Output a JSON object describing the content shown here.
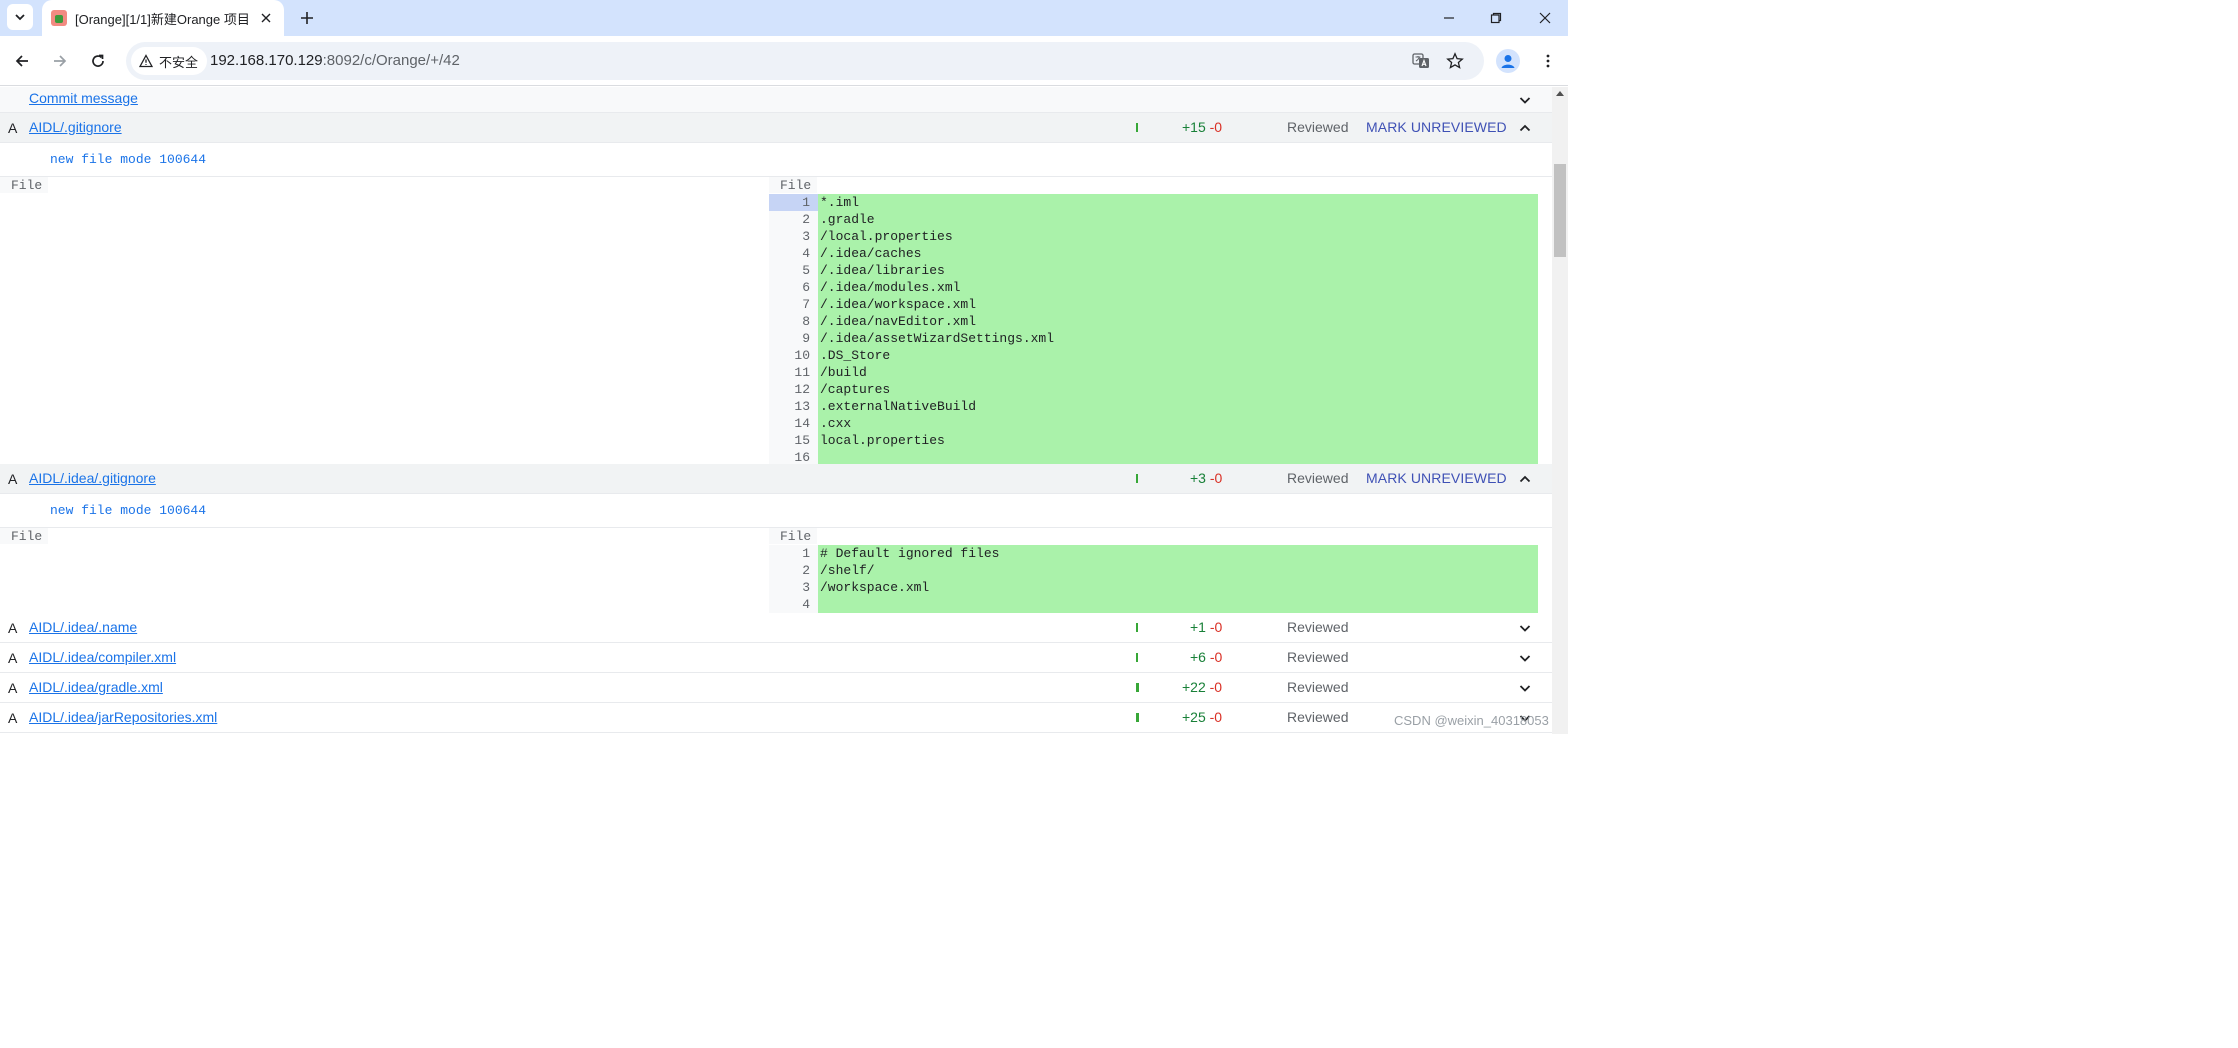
{
  "browser": {
    "tab_title": "[Orange][1/1]新建Orange 项目",
    "security_label": "不安全",
    "url_host": "192.168.170.129",
    "url_rest": ":8092/c/Orange/+/42"
  },
  "page": {
    "commit_message_label": "Commit message",
    "files": [
      {
        "status": "A",
        "path": "AIDL/.gitignore",
        "added": "+15",
        "removed": "-0",
        "reviewed_label": "Reviewed",
        "mark_label": "MARK UNREVIEWED",
        "expanded": true,
        "file_mode": "new file mode 100644",
        "left_header": "File",
        "right_header": "File",
        "lines": [
          {
            "n": "1",
            "text": "*.iml"
          },
          {
            "n": "2",
            "text": ".gradle"
          },
          {
            "n": "3",
            "text": "/local.properties"
          },
          {
            "n": "4",
            "text": "/.idea/caches"
          },
          {
            "n": "5",
            "text": "/.idea/libraries"
          },
          {
            "n": "6",
            "text": "/.idea/modules.xml"
          },
          {
            "n": "7",
            "text": "/.idea/workspace.xml"
          },
          {
            "n": "8",
            "text": "/.idea/navEditor.xml"
          },
          {
            "n": "9",
            "text": "/.idea/assetWizardSettings.xml"
          },
          {
            "n": "10",
            "text": ".DS_Store"
          },
          {
            "n": "11",
            "text": "/build"
          },
          {
            "n": "12",
            "text": "/captures"
          },
          {
            "n": "13",
            "text": ".externalNativeBuild"
          },
          {
            "n": "14",
            "text": ".cxx"
          },
          {
            "n": "15",
            "text": "local.properties"
          },
          {
            "n": "16",
            "text": ""
          }
        ]
      },
      {
        "status": "A",
        "path": "AIDL/.idea/.gitignore",
        "added": "+3",
        "removed": "-0",
        "reviewed_label": "Reviewed",
        "mark_label": "MARK UNREVIEWED",
        "expanded": true,
        "file_mode": "new file mode 100644",
        "left_header": "File",
        "right_header": "File",
        "lines": [
          {
            "n": "1",
            "text": "# Default ignored files"
          },
          {
            "n": "2",
            "text": "/shelf/"
          },
          {
            "n": "3",
            "text": "/workspace.xml"
          },
          {
            "n": "4",
            "text": ""
          }
        ]
      },
      {
        "status": "A",
        "path": "AIDL/.idea/.name",
        "added": "+1",
        "removed": "-0",
        "reviewed_label": "Reviewed"
      },
      {
        "status": "A",
        "path": "AIDL/.idea/compiler.xml",
        "added": "+6",
        "removed": "-0",
        "reviewed_label": "Reviewed"
      },
      {
        "status": "A",
        "path": "AIDL/.idea/gradle.xml",
        "added": "+22",
        "removed": "-0",
        "reviewed_label": "Reviewed"
      },
      {
        "status": "A",
        "path": "AIDL/.idea/jarRepositories.xml",
        "added": "+25",
        "removed": "-0",
        "reviewed_label": "Reviewed"
      }
    ]
  },
  "watermark": "CSDN @weixin_40318053",
  "colors": {
    "added_line_bg": "#aaf2aa",
    "link": "#1a73e8",
    "added_count": "#188038",
    "removed_count": "#d93025",
    "mark_button": "#3f51b5"
  }
}
